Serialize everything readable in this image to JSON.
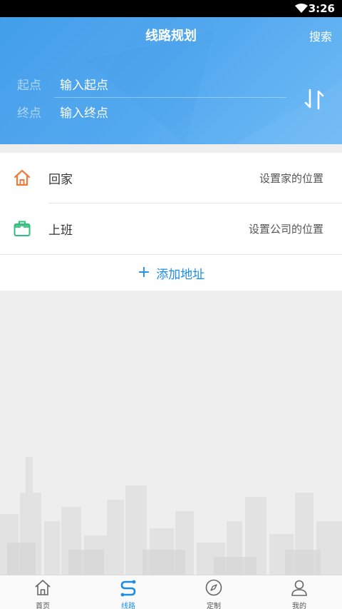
{
  "status": {
    "time": "3:26"
  },
  "header": {
    "title": "线路规划",
    "search": "搜索"
  },
  "route": {
    "start_label": "起点",
    "start_value": "输入起点",
    "end_label": "终点",
    "end_value": "输入终点"
  },
  "places": [
    {
      "name": "回家",
      "hint": "设置家的位置",
      "icon": "home-icon",
      "color": "#f07a3c"
    },
    {
      "name": "上班",
      "hint": "设置公司的位置",
      "icon": "briefcase-icon",
      "color": "#2ec07c"
    }
  ],
  "add_address": "添加地址",
  "tabs": [
    {
      "label": "首页",
      "icon": "home-outline-icon"
    },
    {
      "label": "线路",
      "icon": "route-icon",
      "active": true
    },
    {
      "label": "定制",
      "icon": "compass-icon"
    },
    {
      "label": "我的",
      "icon": "user-icon"
    }
  ],
  "colors": {
    "accent": "#1a8ee6",
    "header_start": "#3a9ae8",
    "header_end": "#6ab8f6"
  }
}
